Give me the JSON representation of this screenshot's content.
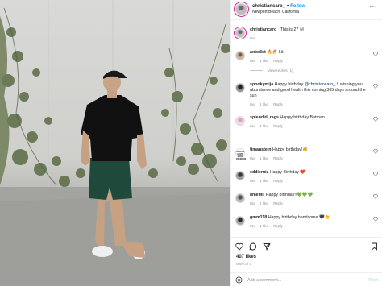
{
  "post": {
    "author": "christiancaro_",
    "follow_label": "Follow",
    "location": "Newport Beach, California",
    "caption": "This is 27 😜",
    "caption_age": "8w"
  },
  "comments": [
    {
      "user": "antw3st",
      "text": "🔥🔥 Lit",
      "age": "8w",
      "likes": "1 like",
      "reply": "Reply",
      "view_replies": "View replies (1)"
    },
    {
      "user": "spookymija",
      "text_pre": "Happy birthday ",
      "mention": "@christiancaro_",
      "text_post": " !! wishing you abundance and good health this coming 365 days around the sun",
      "age": "8w",
      "likes": "1 like",
      "reply": "Reply"
    },
    {
      "user": "splendid_rags",
      "text": "Happy birthday Batman.",
      "age": "8w",
      "likes": "1 like",
      "reply": "Reply",
      "avatar_text": "SPLEN DID RAGS"
    },
    {
      "user": "fjmanstein",
      "text": "Happy birthday!🥳",
      "age": "8w",
      "likes": "1 like",
      "reply": "Reply",
      "avatar_text": "ALWAYS GROW WITH FREEDOM"
    },
    {
      "user": "eddieruiz",
      "text": "Happy Birthday ❤️",
      "age": "8w",
      "likes": "1 like",
      "reply": "Reply"
    },
    {
      "user": "limemil",
      "text": "Happy birthday!!💚💚💚",
      "age": "8w",
      "likes": "1 like",
      "reply": "Reply"
    },
    {
      "user": "gmm118",
      "text": "Happy birthday handsome 🖤👏",
      "age": "8w",
      "likes": "1 like",
      "reply": "Reply"
    }
  ],
  "actions": {
    "icons": [
      "heart-icon",
      "comment-icon",
      "share-icon",
      "bookmark-icon"
    ],
    "likes": "407 likes",
    "date": "MARCH 1",
    "comment_placeholder": "Add a comment...",
    "post_label": "Post",
    "emoji_icon": "emoji-icon"
  },
  "colors": {
    "link_blue": "#0095f6",
    "post_disabled": "#b2dffc",
    "secondary_text": "#8e8e8e",
    "story_ring": "#d6249f"
  }
}
